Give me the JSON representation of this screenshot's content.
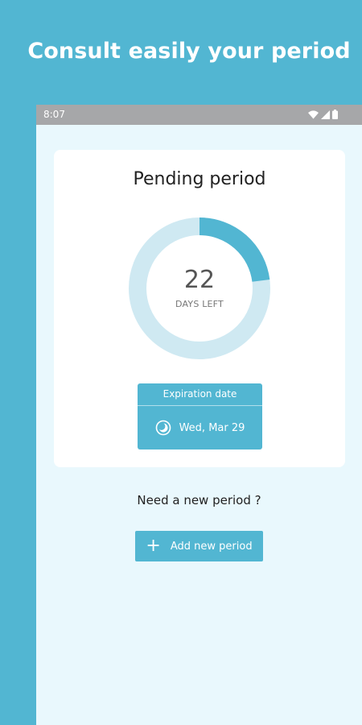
{
  "promo": {
    "title": "Consult easily your period"
  },
  "status_bar": {
    "time": "8:07",
    "icons": [
      "wifi-icon",
      "signal-icon",
      "battery-icon"
    ]
  },
  "card": {
    "title": "Pending period",
    "days_left": "22",
    "days_left_label": "DAYS LEFT",
    "progress_fraction": 0.23,
    "expiration": {
      "header": "Expiration date",
      "date": "Wed, Mar 29",
      "icon": "moon-icon"
    }
  },
  "new_period": {
    "question": "Need a new period ?",
    "button_label": "Add new period",
    "button_icon": "plus-icon"
  },
  "colors": {
    "accent": "#52b6d2",
    "ring_track": "#cfe9f2",
    "screen_background": "#e9f8fd",
    "status_bar": "#a6a7a9"
  }
}
